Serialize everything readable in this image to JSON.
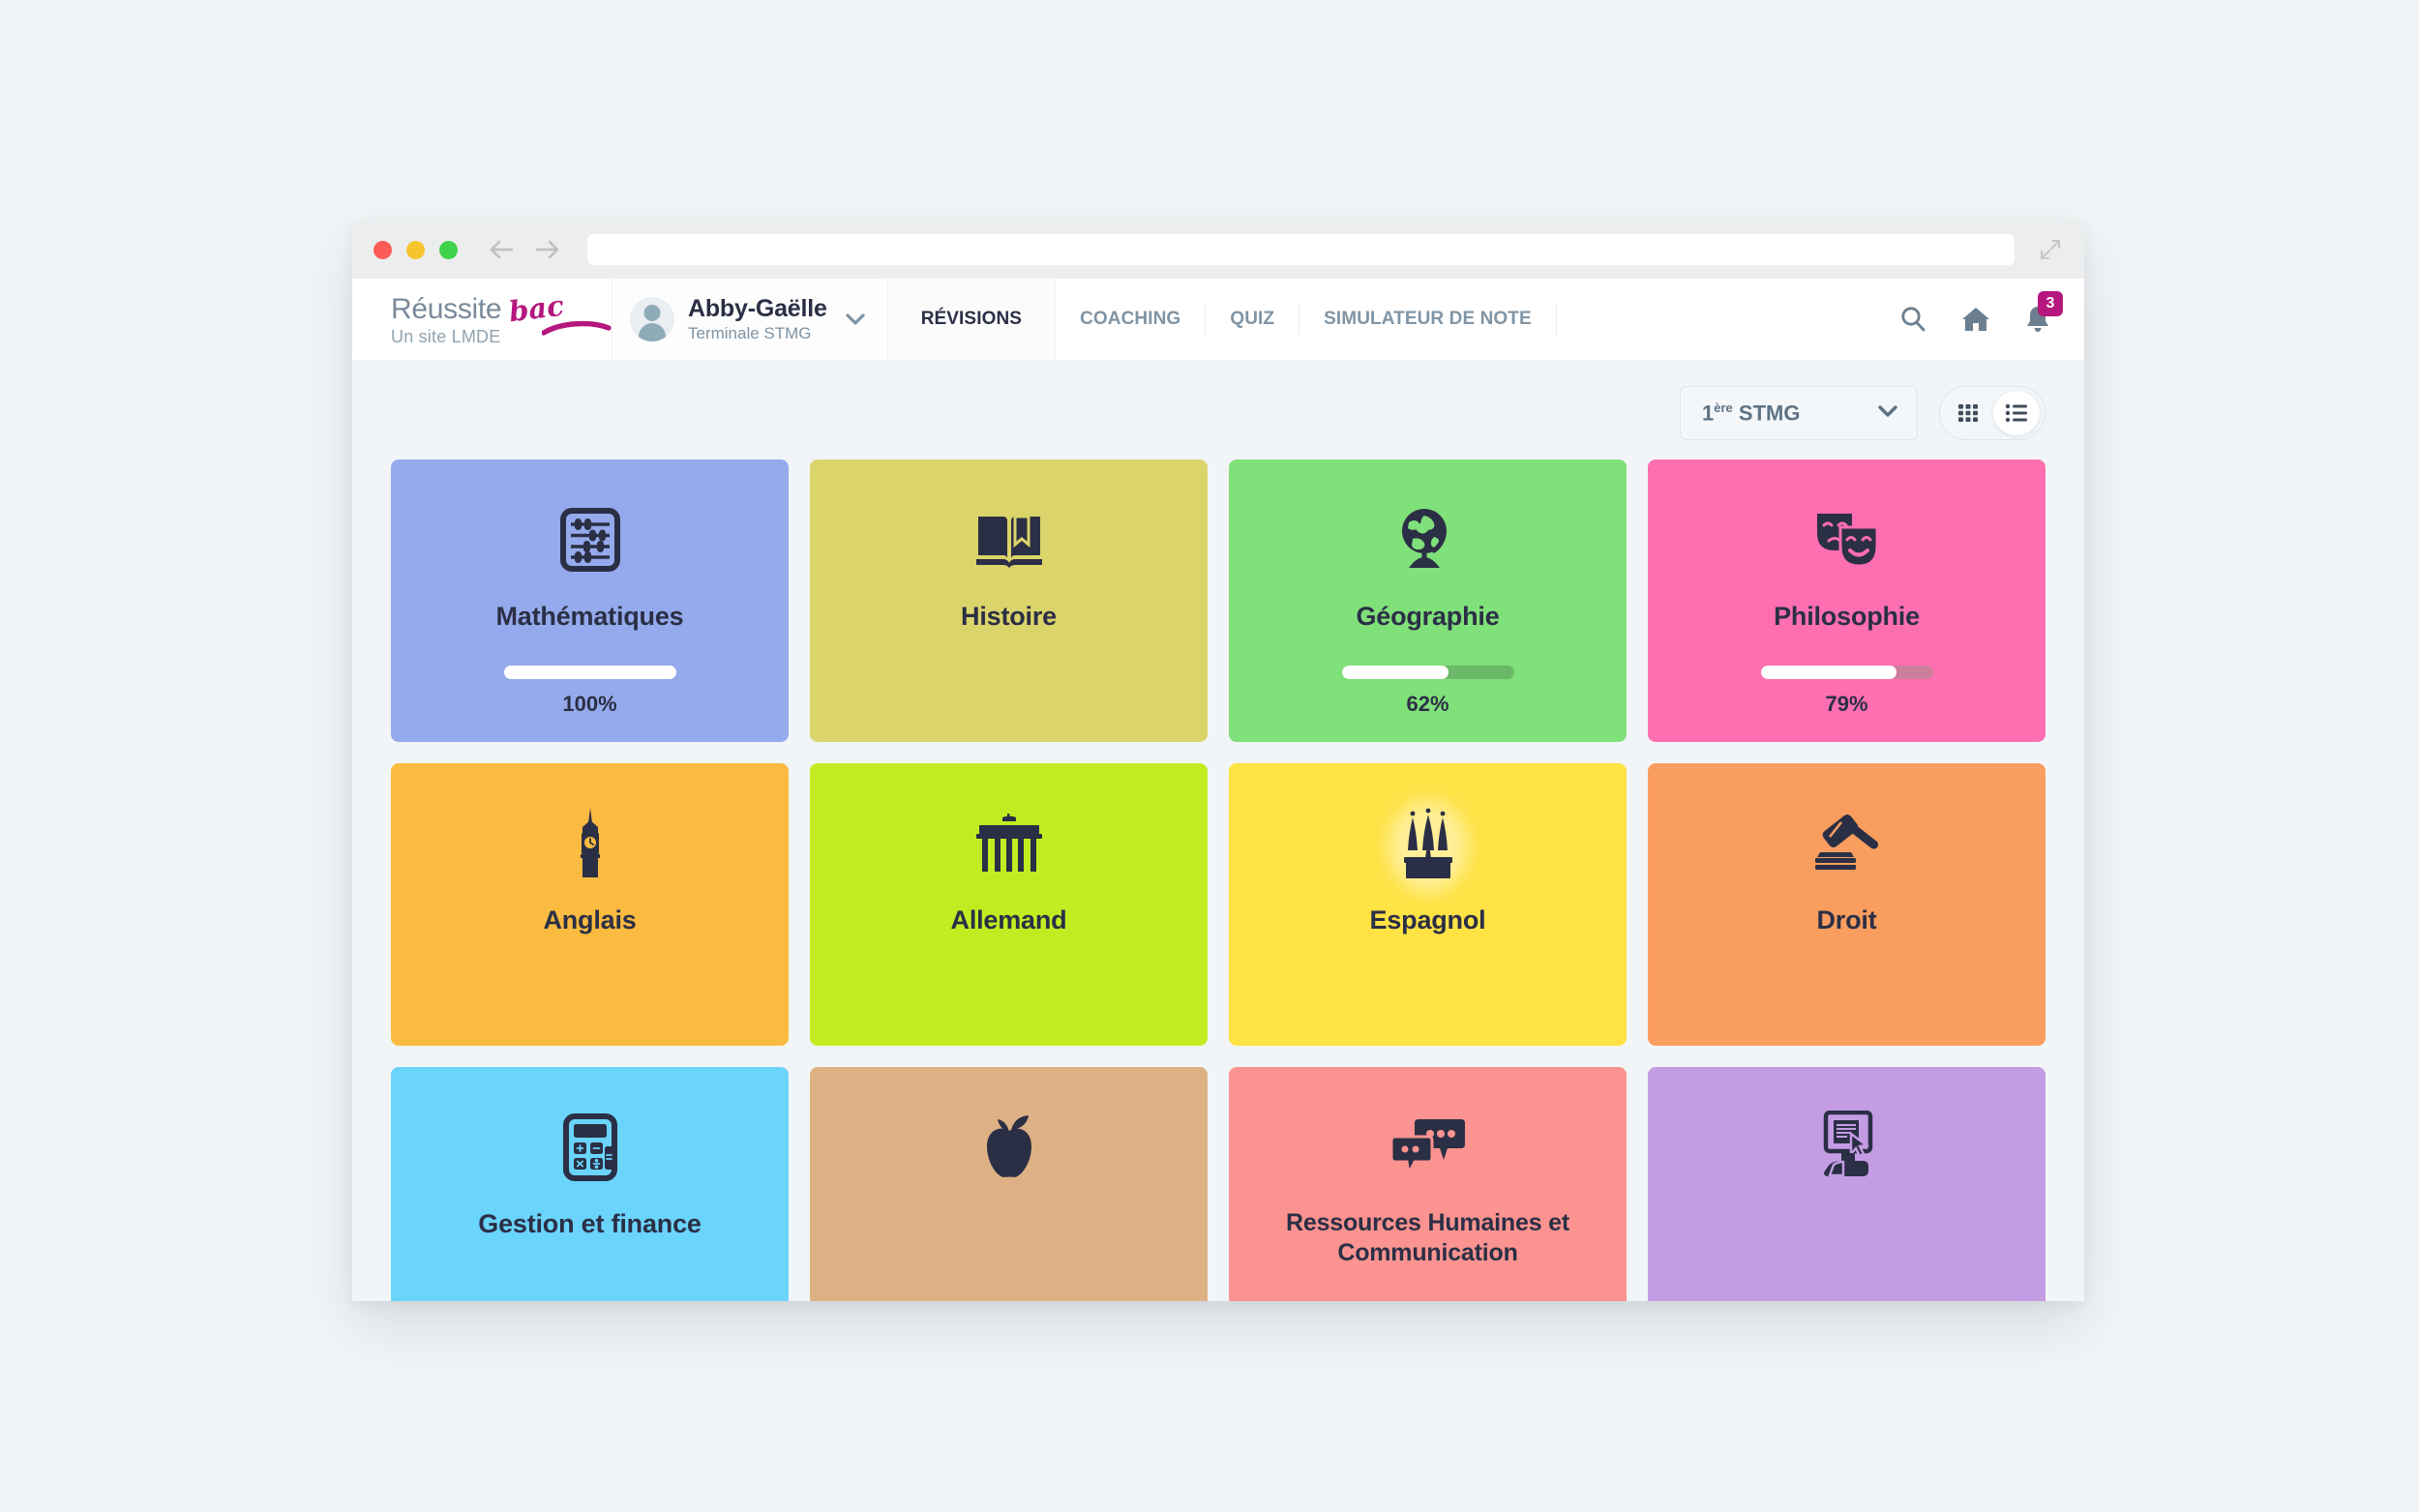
{
  "browser": {
    "url_value": "",
    "url_placeholder": ""
  },
  "brand": {
    "name": "Réussite",
    "accent": "bac",
    "subtitle": "Un site LMDE",
    "accent_color": "#b5177e"
  },
  "user": {
    "name": "Abby-Gaëlle",
    "grade": "Terminale STMG"
  },
  "nav": {
    "items": [
      {
        "label": "RÉVISIONS",
        "active": true
      },
      {
        "label": "COACHING",
        "active": false
      },
      {
        "label": "QUIZ",
        "active": false
      },
      {
        "label": "SIMULATEUR DE NOTE",
        "active": false
      }
    ],
    "notification_count": "3",
    "badge_color": "#b5177e"
  },
  "toolbar": {
    "filter_value": "1ère STMG",
    "filter_value_main": "1",
    "filter_value_sup": "ère",
    "filter_value_rest": " STMG",
    "view_grid": "grid-view",
    "view_list": "list-view",
    "active_view": "list"
  },
  "subjects": [
    {
      "title": "Mathématiques",
      "icon": "abacus-icon",
      "color": "#94aaec",
      "progress": 100,
      "progress_label": "100%",
      "track_color": "rgba(255,255,255,0.45)"
    },
    {
      "title": "Histoire",
      "icon": "open-book-icon",
      "color": "#dbd46a",
      "progress": null,
      "progress_label": "",
      "track_color": "rgba(255,255,255,0.45)"
    },
    {
      "title": "Géographie",
      "icon": "globe-stand-icon",
      "color": "#80e07a",
      "progress": 62,
      "progress_label": "62%",
      "track_color": "#6bb868"
    },
    {
      "title": "Philosophie",
      "icon": "theatre-masks-icon",
      "color": "#fd6fb0",
      "progress": 79,
      "progress_label": "79%",
      "track_color": "#cd7e9c"
    },
    {
      "title": "Anglais",
      "icon": "big-ben-icon",
      "color": "#fbbb40",
      "progress": null,
      "progress_label": "",
      "track_color": "rgba(255,255,255,0.45)"
    },
    {
      "title": "Allemand",
      "icon": "brandenburg-gate-icon",
      "color": "#c2ec21",
      "progress": null,
      "progress_label": "",
      "track_color": "rgba(255,255,255,0.45)"
    },
    {
      "title": "Espagnol",
      "icon": "sagrada-familia-icon",
      "color": "#ffe244",
      "progress": null,
      "progress_label": "",
      "track_color": "rgba(255,255,255,0.45)"
    },
    {
      "title": "Droit",
      "icon": "gavel-icon",
      "color": "#fa9e5f",
      "progress": null,
      "progress_label": "",
      "track_color": "rgba(255,255,255,0.45)"
    },
    {
      "title": "Gestion et finance",
      "icon": "calculator-icon",
      "color": "#6ad4fb",
      "progress": null,
      "progress_label": "",
      "track_color": "rgba(255,255,255,0.45)"
    },
    {
      "title": "",
      "icon": "apple-icon",
      "color": "#deb184",
      "progress": null,
      "progress_label": "",
      "track_color": "rgba(255,255,255,0.45)"
    },
    {
      "title": "Ressources Humaines et Communication",
      "icon": "speech-bubbles-icon",
      "color": "#fb9390",
      "progress": null,
      "progress_label": "",
      "track_color": "rgba(255,255,255,0.45)"
    },
    {
      "title": "",
      "icon": "computer-mouse-icon",
      "color": "#c49ce4",
      "progress": null,
      "progress_label": "",
      "track_color": "rgba(255,255,255,0.45)"
    }
  ]
}
